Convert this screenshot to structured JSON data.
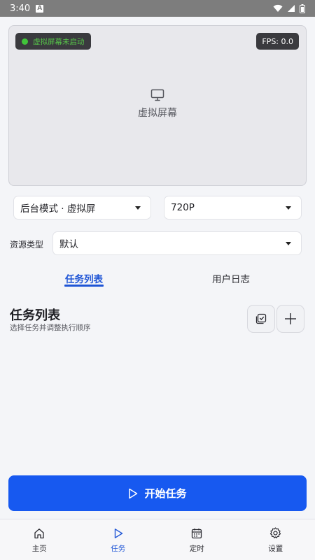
{
  "status_bar": {
    "time": "3:40",
    "notification_glyph": "A"
  },
  "virtual_screen": {
    "status_text": "虚拟屏幕未启动",
    "fps_text": "FPS: 0.0",
    "placeholder_label": "虚拟屏幕",
    "status_color": "#41c43a"
  },
  "controls": {
    "mode_select": {
      "value": "后台模式 · 虚拟屏"
    },
    "resolution_select": {
      "value": "720P"
    },
    "resource_type": {
      "label": "资源类型",
      "value": "默认"
    }
  },
  "tabs": [
    {
      "label": "任务列表",
      "active": true
    },
    {
      "label": "用户日志",
      "active": false
    }
  ],
  "task_section": {
    "title": "任务列表",
    "subtitle": "选择任务并调整执行顺序"
  },
  "start_button": {
    "label": "开始任务"
  },
  "bottom_nav": [
    {
      "label": "主页",
      "icon": "home-icon",
      "active": false
    },
    {
      "label": "任务",
      "icon": "play-icon",
      "active": true
    },
    {
      "label": "定时",
      "icon": "calendar-icon",
      "active": false
    },
    {
      "label": "设置",
      "icon": "gear-icon",
      "active": false
    }
  ],
  "colors": {
    "accent": "#1759f0",
    "active_tab": "#1f55d6"
  }
}
